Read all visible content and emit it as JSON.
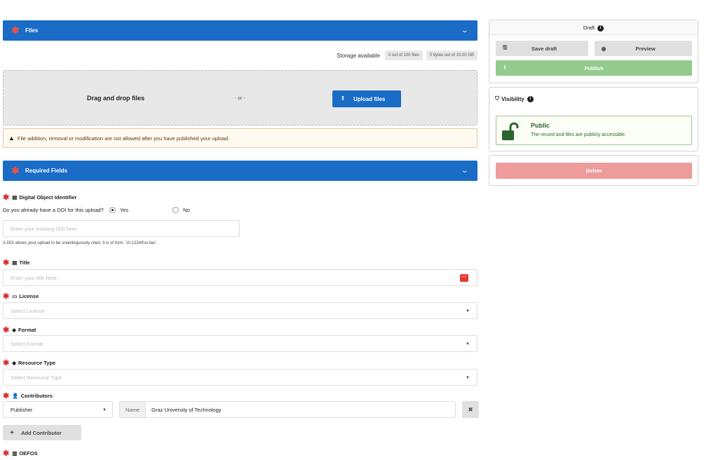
{
  "files_section": {
    "title": "Files"
  },
  "storage": {
    "label": "Storage available",
    "files_pill": "0 out of 100 files",
    "bytes_pill": "0 bytes out of 10.00 GB"
  },
  "dropzone": {
    "drag_text": "Drag and drop files",
    "or_text": "- or -",
    "upload_label": "Upload files"
  },
  "warning": {
    "text": "File addition, removal or modification are not allowed after you have published your upload."
  },
  "required_section": {
    "title": "Required Fields"
  },
  "doi": {
    "label": "Digital Object Identifier",
    "question": "Do you already have a DOI for this upload?",
    "yes": "Yes",
    "no": "No",
    "selected": "Yes",
    "placeholder": "Enter your existing DOI here.",
    "hint": "A DOI allows your upload to be unambiguously cited. It is of form `10.1234/foo.bar`."
  },
  "title_field": {
    "label": "Title",
    "placeholder": "Enter your title here."
  },
  "license": {
    "label": "License",
    "placeholder": "Select License"
  },
  "format": {
    "label": "Format",
    "placeholder": "Select Format"
  },
  "resource_type": {
    "label": "Resource Type",
    "placeholder": "Select Resource Type"
  },
  "contributors": {
    "label": "Contributors",
    "role": "Publisher",
    "name_label": "Name",
    "name_value": "Graz University of Technology",
    "add_label": "Add Contributor"
  },
  "oefos": {
    "label": "OEFOS"
  },
  "sidebar": {
    "draft_title": "Draft",
    "save_draft": "Save draft",
    "preview": "Preview",
    "publish": "Publish",
    "visibility_title": "Visibility",
    "public_title": "Public",
    "public_desc": "The record and files are publicly accessible.",
    "delete": "Delete"
  },
  "colors": {
    "primary": "#1a6cc6",
    "publish": "#93cb8d",
    "delete": "#ee9b9b",
    "public_green": "#2c662d",
    "required": "#db2828"
  }
}
